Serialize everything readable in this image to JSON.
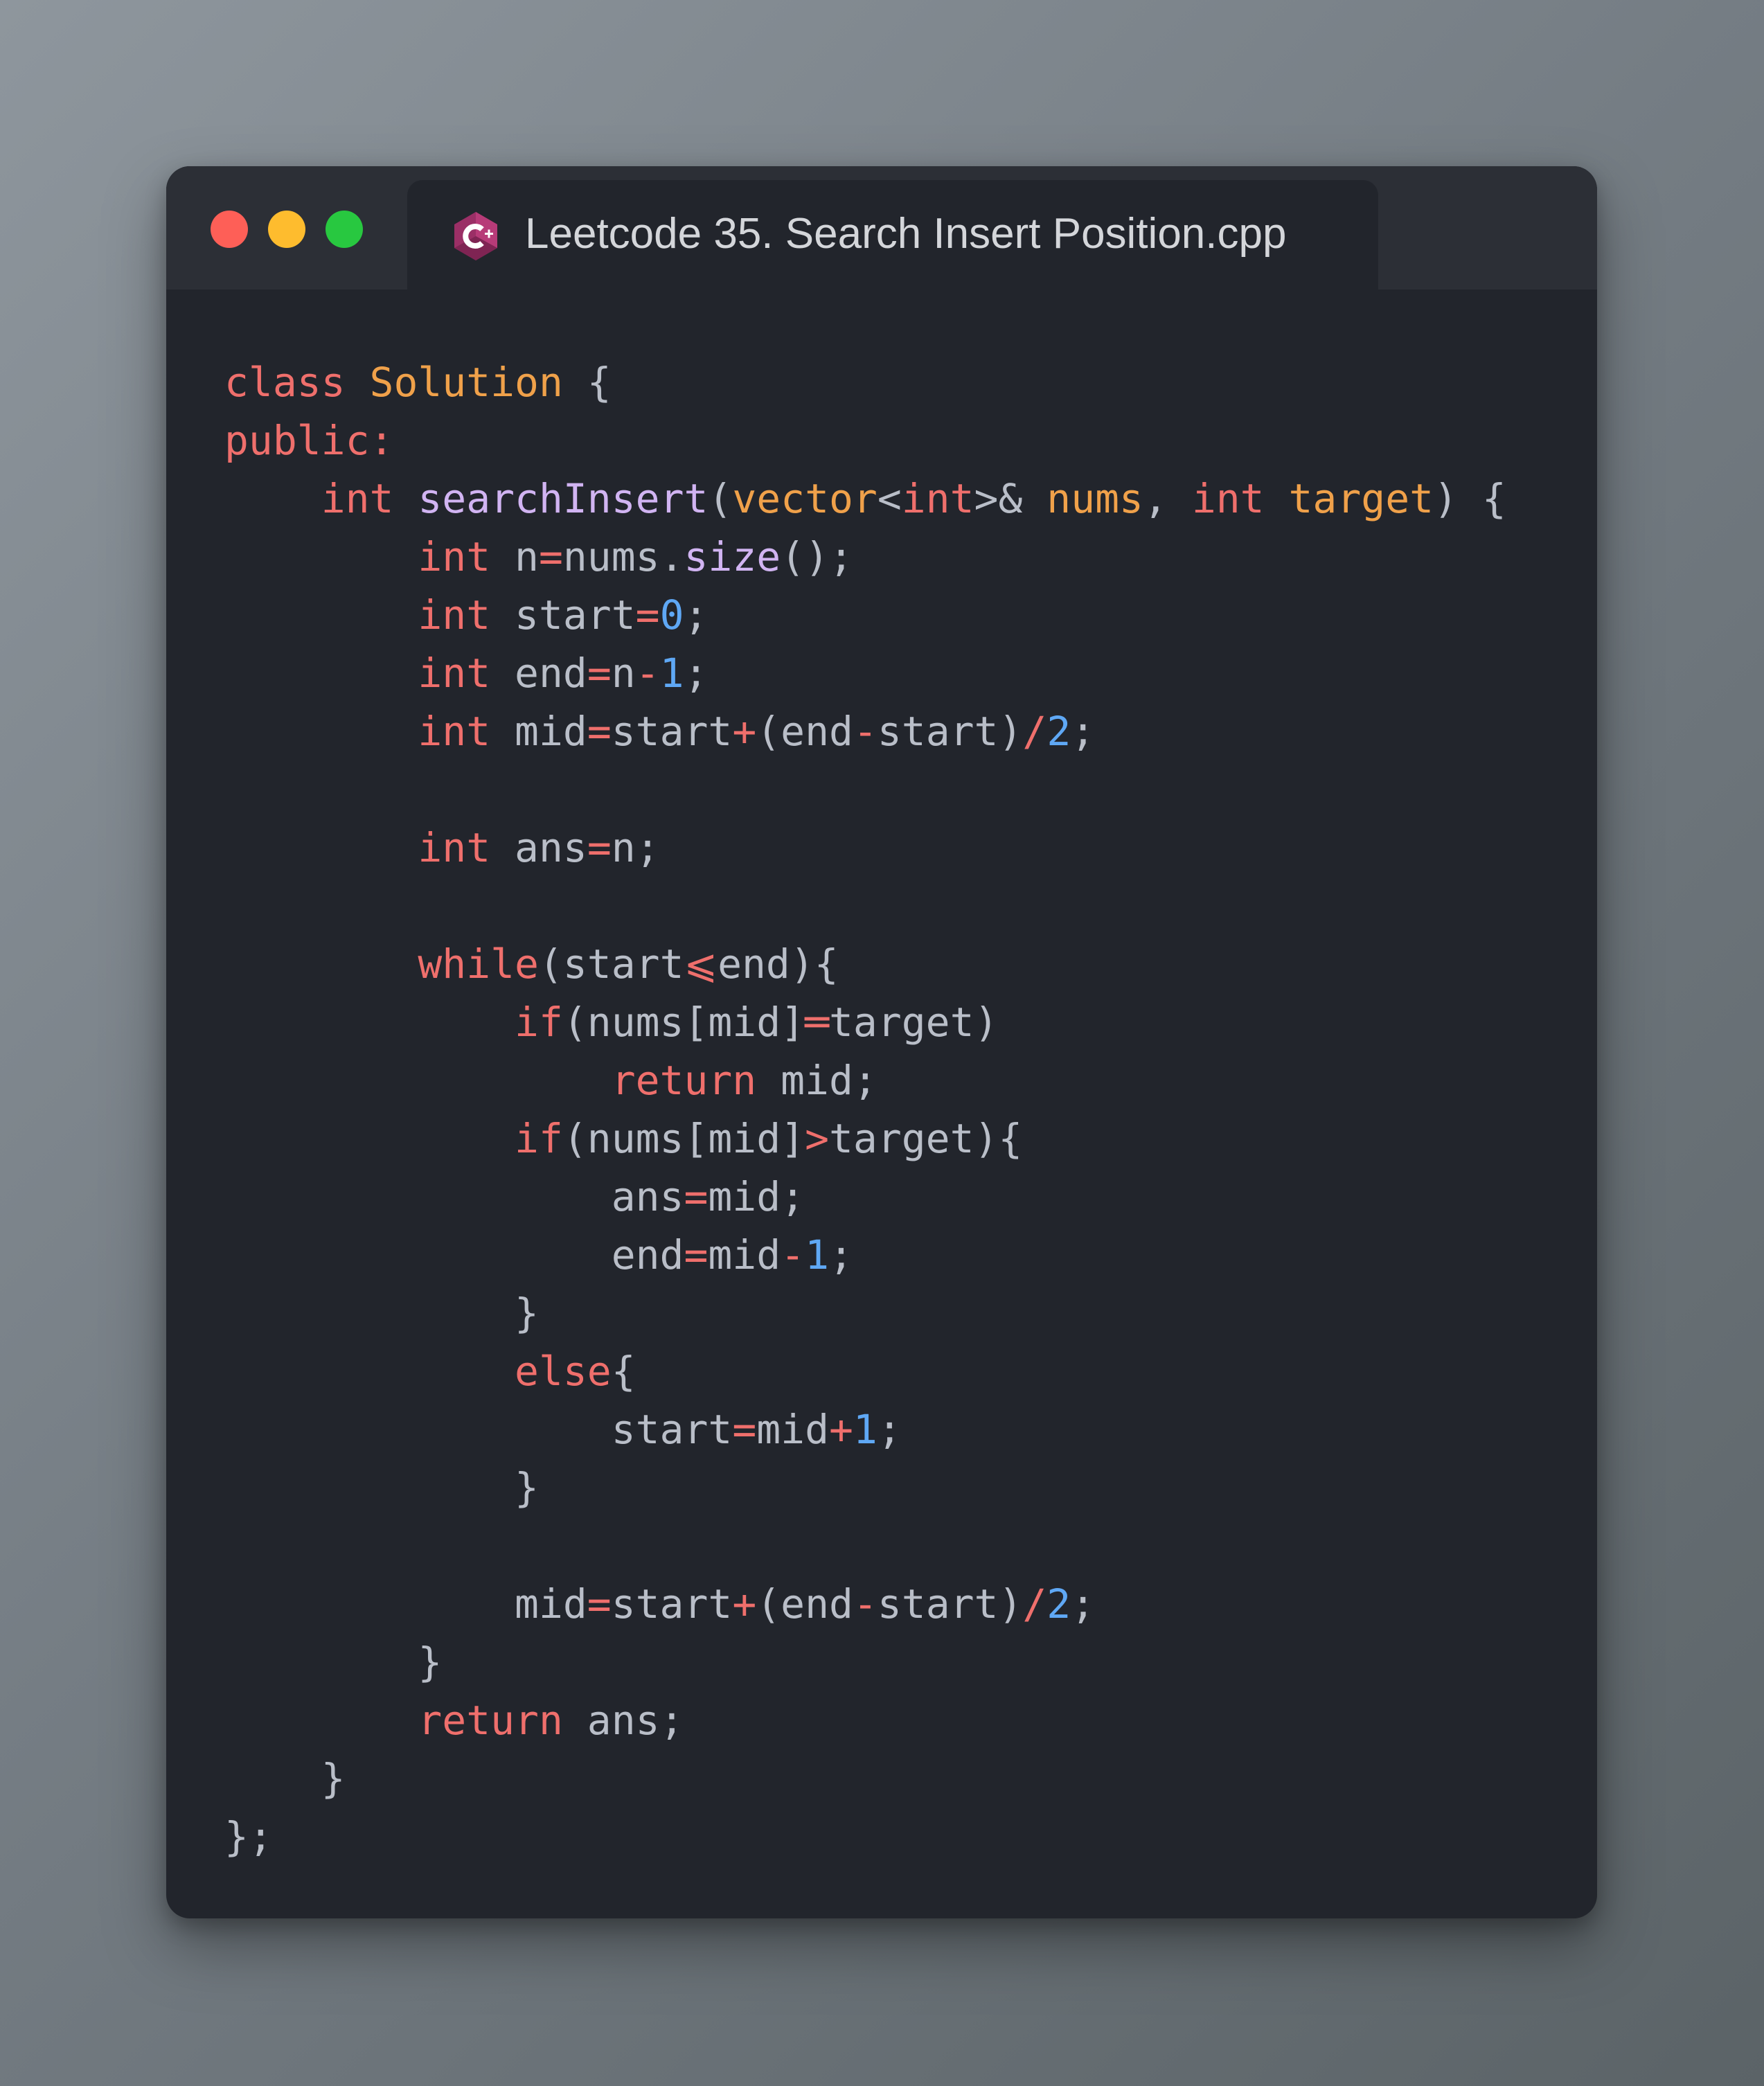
{
  "window": {
    "controls": [
      {
        "name": "close",
        "color": "#fe5f57"
      },
      {
        "name": "minimize",
        "color": "#febc2e"
      },
      {
        "name": "maximize",
        "color": "#28c840"
      }
    ],
    "tab": {
      "title": "Leetcode 35. Search Insert Position.cpp",
      "icon": "cpp-file-icon"
    }
  },
  "code": {
    "lines": [
      [
        [
          "keyword",
          "class"
        ],
        [
          "plain",
          " "
        ],
        [
          "type",
          "Solution"
        ],
        [
          "plain",
          " {"
        ]
      ],
      [
        [
          "keyword",
          "public:"
        ]
      ],
      [
        [
          "plain",
          "    "
        ],
        [
          "keyword",
          "int"
        ],
        [
          "plain",
          " "
        ],
        [
          "func",
          "searchInsert"
        ],
        [
          "plain",
          "("
        ],
        [
          "type",
          "vector"
        ],
        [
          "plain",
          "<"
        ],
        [
          "keyword",
          "int"
        ],
        [
          "plain",
          ">& "
        ],
        [
          "param",
          "nums"
        ],
        [
          "plain",
          ", "
        ],
        [
          "keyword",
          "int"
        ],
        [
          "plain",
          " "
        ],
        [
          "param",
          "target"
        ],
        [
          "plain",
          ") {"
        ]
      ],
      [
        [
          "plain",
          "        "
        ],
        [
          "keyword",
          "int"
        ],
        [
          "plain",
          " n"
        ],
        [
          "operator",
          "="
        ],
        [
          "plain",
          "nums."
        ],
        [
          "func",
          "size"
        ],
        [
          "plain",
          "();"
        ]
      ],
      [
        [
          "plain",
          "        "
        ],
        [
          "keyword",
          "int"
        ],
        [
          "plain",
          " start"
        ],
        [
          "operator",
          "="
        ],
        [
          "number",
          "0"
        ],
        [
          "plain",
          ";"
        ]
      ],
      [
        [
          "plain",
          "        "
        ],
        [
          "keyword",
          "int"
        ],
        [
          "plain",
          " end"
        ],
        [
          "operator",
          "="
        ],
        [
          "plain",
          "n"
        ],
        [
          "operator",
          "-"
        ],
        [
          "number",
          "1"
        ],
        [
          "plain",
          ";"
        ]
      ],
      [
        [
          "plain",
          "        "
        ],
        [
          "keyword",
          "int"
        ],
        [
          "plain",
          " mid"
        ],
        [
          "operator",
          "="
        ],
        [
          "plain",
          "start"
        ],
        [
          "operator",
          "+"
        ],
        [
          "plain",
          "(end"
        ],
        [
          "operator",
          "-"
        ],
        [
          "plain",
          "start)"
        ],
        [
          "operator",
          "/"
        ],
        [
          "number",
          "2"
        ],
        [
          "plain",
          ";"
        ]
      ],
      [],
      [
        [
          "plain",
          "        "
        ],
        [
          "keyword",
          "int"
        ],
        [
          "plain",
          " ans"
        ],
        [
          "operator",
          "="
        ],
        [
          "plain",
          "n;"
        ]
      ],
      [],
      [
        [
          "plain",
          "        "
        ],
        [
          "keyword",
          "while"
        ],
        [
          "plain",
          "(start"
        ],
        [
          "operator",
          "⩽"
        ],
        [
          "plain",
          "end){"
        ]
      ],
      [
        [
          "plain",
          "            "
        ],
        [
          "keyword",
          "if"
        ],
        [
          "plain",
          "(nums[mid]"
        ],
        [
          "operator",
          "═"
        ],
        [
          "plain",
          "target)"
        ]
      ],
      [
        [
          "plain",
          "                "
        ],
        [
          "keyword",
          "return"
        ],
        [
          "plain",
          " mid;"
        ]
      ],
      [
        [
          "plain",
          "            "
        ],
        [
          "keyword",
          "if"
        ],
        [
          "plain",
          "(nums[mid]"
        ],
        [
          "operator",
          ">"
        ],
        [
          "plain",
          "target){"
        ]
      ],
      [
        [
          "plain",
          "                ans"
        ],
        [
          "operator",
          "="
        ],
        [
          "plain",
          "mid;"
        ]
      ],
      [
        [
          "plain",
          "                end"
        ],
        [
          "operator",
          "="
        ],
        [
          "plain",
          "mid"
        ],
        [
          "operator",
          "-"
        ],
        [
          "number",
          "1"
        ],
        [
          "plain",
          ";"
        ]
      ],
      [
        [
          "plain",
          "            }"
        ]
      ],
      [
        [
          "plain",
          "            "
        ],
        [
          "keyword",
          "else"
        ],
        [
          "plain",
          "{"
        ]
      ],
      [
        [
          "plain",
          "                start"
        ],
        [
          "operator",
          "="
        ],
        [
          "plain",
          "mid"
        ],
        [
          "operator",
          "+"
        ],
        [
          "number",
          "1"
        ],
        [
          "plain",
          ";"
        ]
      ],
      [
        [
          "plain",
          "            }"
        ]
      ],
      [],
      [
        [
          "plain",
          "            mid"
        ],
        [
          "operator",
          "="
        ],
        [
          "plain",
          "start"
        ],
        [
          "operator",
          "+"
        ],
        [
          "plain",
          "(end"
        ],
        [
          "operator",
          "-"
        ],
        [
          "plain",
          "start)"
        ],
        [
          "operator",
          "/"
        ],
        [
          "number",
          "2"
        ],
        [
          "plain",
          ";"
        ]
      ],
      [
        [
          "plain",
          "        }"
        ]
      ],
      [
        [
          "plain",
          "        "
        ],
        [
          "keyword",
          "return"
        ],
        [
          "plain",
          " ans;"
        ]
      ],
      [
        [
          "plain",
          "    }"
        ]
      ],
      [
        [
          "plain",
          "};"
        ]
      ]
    ]
  }
}
